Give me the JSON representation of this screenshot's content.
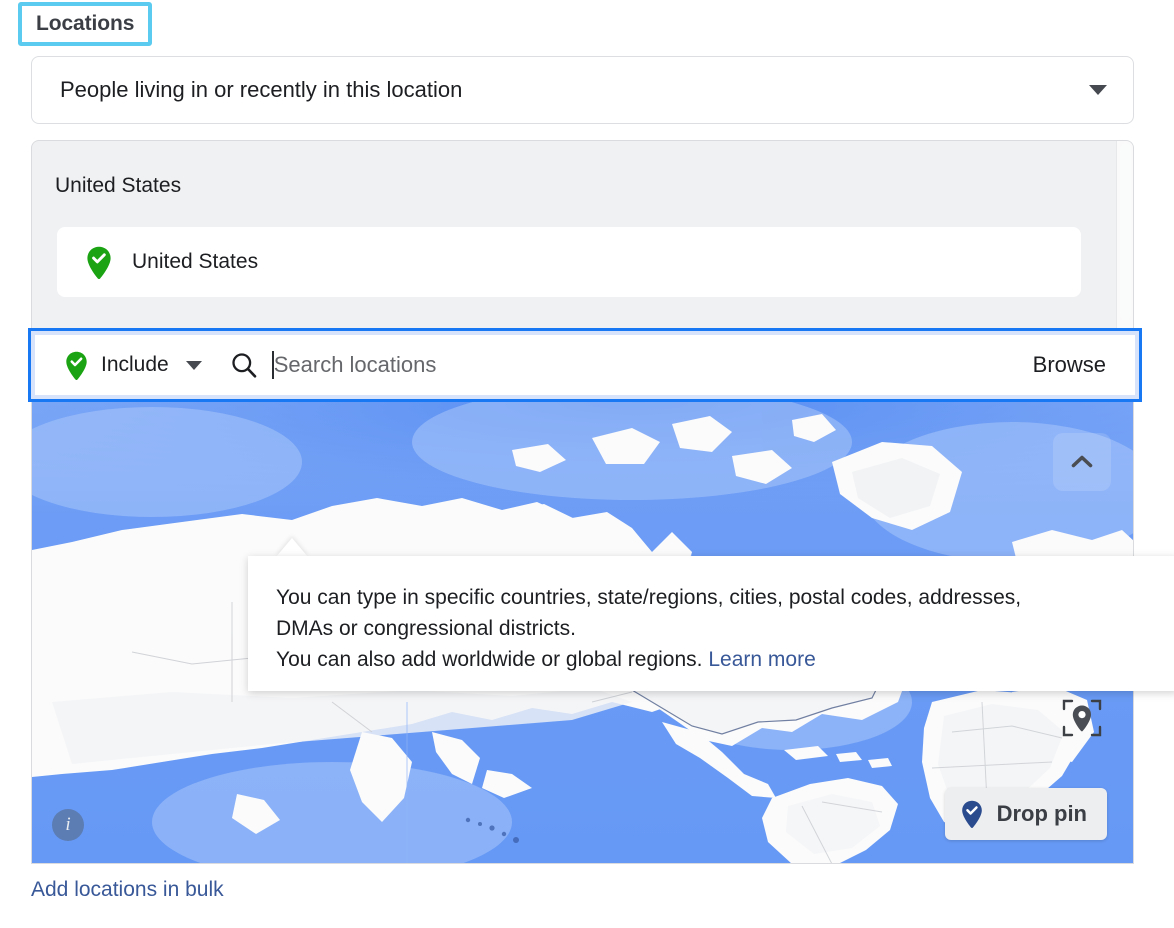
{
  "section": {
    "label": "Locations"
  },
  "audience_type_select": {
    "value": "People living in or recently in this location",
    "caret_icon": "chevron-down-icon"
  },
  "selected_locations": {
    "group_title": "United States",
    "items": [
      {
        "label": "United States",
        "state": "included",
        "icon": "map-pin-check-icon"
      }
    ]
  },
  "search_row": {
    "mode_label": "Include",
    "mode_icon": "map-pin-check-icon",
    "mode_caret_icon": "chevron-down-icon",
    "search_icon": "search-icon",
    "search_value": "",
    "search_placeholder": "Search locations",
    "browse_label": "Browse"
  },
  "map": {
    "collapse_icon": "chevron-up-icon",
    "target_icon": "pin-target-icon",
    "drop_pin_label": "Drop pin",
    "drop_pin_icon": "map-pin-check-icon",
    "info_icon": "info-icon",
    "info_glyph": "i",
    "colors": {
      "ocean": "#6c9cf5",
      "ocean_deep": "#4f89f2",
      "shelf": "#9fc0f8",
      "land": "#fbfbfb",
      "land_shade": "#eef0f2",
      "border": "#c9ccd1"
    }
  },
  "tooltip": {
    "line1": "You can type in specific countries, state/regions, cities, postal codes, addresses,",
    "line2": "DMAs or congressional districts.",
    "line3": "You can also add worldwide or global regions.",
    "link": "Learn more"
  },
  "footer": {
    "bulk_link": "Add locations in bulk"
  },
  "accents": {
    "focus_cyan": "#5bcbef",
    "focus_blue": "#1877f2",
    "link_blue": "#385898",
    "pin_green": "#1ba313",
    "pin_navy": "#2b4b8f"
  }
}
